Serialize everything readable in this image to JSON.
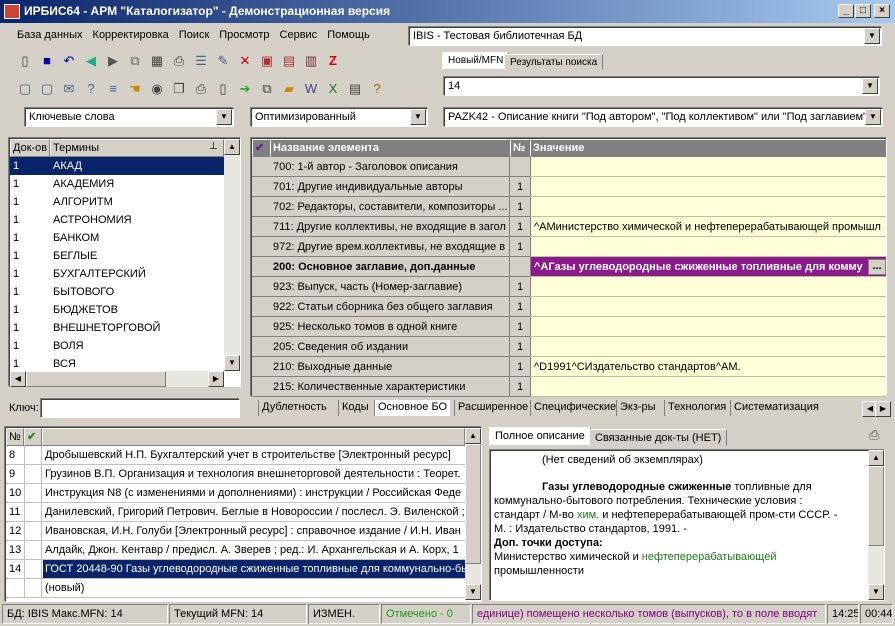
{
  "window": {
    "title": "ИРБИС64 - АРМ \"Каталогизатор\" - Демонстрационная версия",
    "min": "_",
    "max": "□",
    "close": "×"
  },
  "menu": [
    "База данных",
    "Корректировка",
    "Поиск",
    "Просмотр",
    "Сервис",
    "Помощь"
  ],
  "db_select": "IBIS - Тестовая библиотечная БД",
  "mfn_tabs": [
    "Новый/MFN",
    "Результаты поиска"
  ],
  "mfn_value": "14",
  "search_mode": "Ключевые слова",
  "search_type": "Оптимизированный",
  "worksheet": "PAZK42 - Описание книги \"Под автором\", \"Под коллективом\" или \"Под заглавием\"",
  "terms": {
    "headers": [
      "Док-ов",
      "Термины"
    ],
    "rows": [
      [
        "1",
        "АКАД"
      ],
      [
        "1",
        "АКАДЕМИЯ"
      ],
      [
        "1",
        "АЛГОРИТМ"
      ],
      [
        "1",
        "АСТРОНОМИЯ"
      ],
      [
        "1",
        "БАНКОМ"
      ],
      [
        "1",
        "БЕГЛЫЕ"
      ],
      [
        "1",
        "БУХГАЛТЕРСКИЙ"
      ],
      [
        "1",
        "БЫТОВОГО"
      ],
      [
        "1",
        "БЮДЖЕТОВ"
      ],
      [
        "1",
        "ВНЕШНЕТОРГОВОЙ"
      ],
      [
        "1",
        "ВОЛЯ"
      ],
      [
        "1",
        "ВСЯ"
      ]
    ],
    "key_label": "Ключ:"
  },
  "fields": {
    "headers": [
      "Название элемента",
      "№",
      "Значение"
    ],
    "rows": [
      {
        "name": "700: 1-й автор - Заголовок описания",
        "n": "",
        "v": ""
      },
      {
        "name": "701: Другие индивидуальные авторы",
        "n": "1",
        "v": ""
      },
      {
        "name": "702: Редакторы, составители, композиторы ...",
        "n": "1",
        "v": ""
      },
      {
        "name": "711: Другие коллективы, не входящие в загол",
        "n": "1",
        "v": "^AМинистерство химической и нефтеперерабатывающей промышл"
      },
      {
        "name": "972: Другие врем.коллективы, не входящие в",
        "n": "1",
        "v": ""
      },
      {
        "name": "200: Основное заглавие, доп.данные",
        "n": "",
        "v": "^AГазы углеводородные сжиженные топливные для комму"
      },
      {
        "name": "923: Выпуск, часть (Номер-заглавие)",
        "n": "1",
        "v": ""
      },
      {
        "name": "922: Статьи сборника без общего заглавия",
        "n": "1",
        "v": ""
      },
      {
        "name": "925: Несколько томов в одной книге",
        "n": "1",
        "v": ""
      },
      {
        "name": "205: Сведения об издании",
        "n": "1",
        "v": ""
      },
      {
        "name": "210: Выходные данные",
        "n": "1",
        "v": "^D1991^CИздательство стандартов^AM."
      },
      {
        "name": "215: Количественные характеристики",
        "n": "1",
        "v": ""
      }
    ],
    "ellipsis": "..."
  },
  "worksheet_tabs": [
    "Дублетность",
    "Коды",
    "Основное БО",
    "Расширенное",
    "Специфические",
    "Экз-ры",
    "Технология",
    "Систематизация"
  ],
  "docs": {
    "header_no": "№",
    "rows": [
      [
        "8",
        "Дробышевский Н.П. Бухгалтерский учет в строительстве [Электронный ресурс]"
      ],
      [
        "9",
        "Грузинов В.П. Организация и технология внешнеторговой деятельности : Теорет."
      ],
      [
        "10",
        "Инструкция N8   (с изменениями и дополнениями) : инструкции / Российская Феде"
      ],
      [
        "11",
        "Данилевский, Григорий Петрович. Беглые в Новороссии / послесл. Э. Виленской ;"
      ],
      [
        "12",
        "Ивановская, И.Н. Голуби [Электронный ресурс] : справочное издание / И.Н. Иван"
      ],
      [
        "13",
        "Алдайк, Джон. Кентавр / предисл. А. Зверев ; ред.: И. Архангельская и А. Корх, 1"
      ],
      [
        "14",
        "ГОСТ 20448-90 Газы углеводородные сжиженные топливные для коммунально-бы"
      ],
      [
        "",
        "(новый)"
      ]
    ]
  },
  "desc_tabs": [
    "Полное описание",
    "Связанные док-ты (НЕТ)"
  ],
  "description": {
    "line1": "(Нет сведений об экземплярах)",
    "title_bold": "Газы углеводородные сжиженные",
    "title_rest": " топливные для коммунально-бытового потребления. Технические условия : стандарт / М-во ",
    "link1": "хим.",
    "mid": " и нефтеперерабатывающей пром-сти СССР. - М. : Издательство стандартов, 1991. -",
    "access_label": "Доп. точки доступа:",
    "access_pre": "Министерство химической и ",
    "link2": "нефтеперерабатывающей",
    "access_post": " промышленности"
  },
  "status": {
    "db": "БД: IBIS Макс.MFN: 14",
    "current": "Текущий MFN: 14",
    "changed": "ИЗМЕН.",
    "marked": "Отмечено - 0",
    "hint": "единице) помещено несколько томов (выпусков), то в поле вводят",
    "time": "14:25",
    "elapsed": "00:44"
  }
}
